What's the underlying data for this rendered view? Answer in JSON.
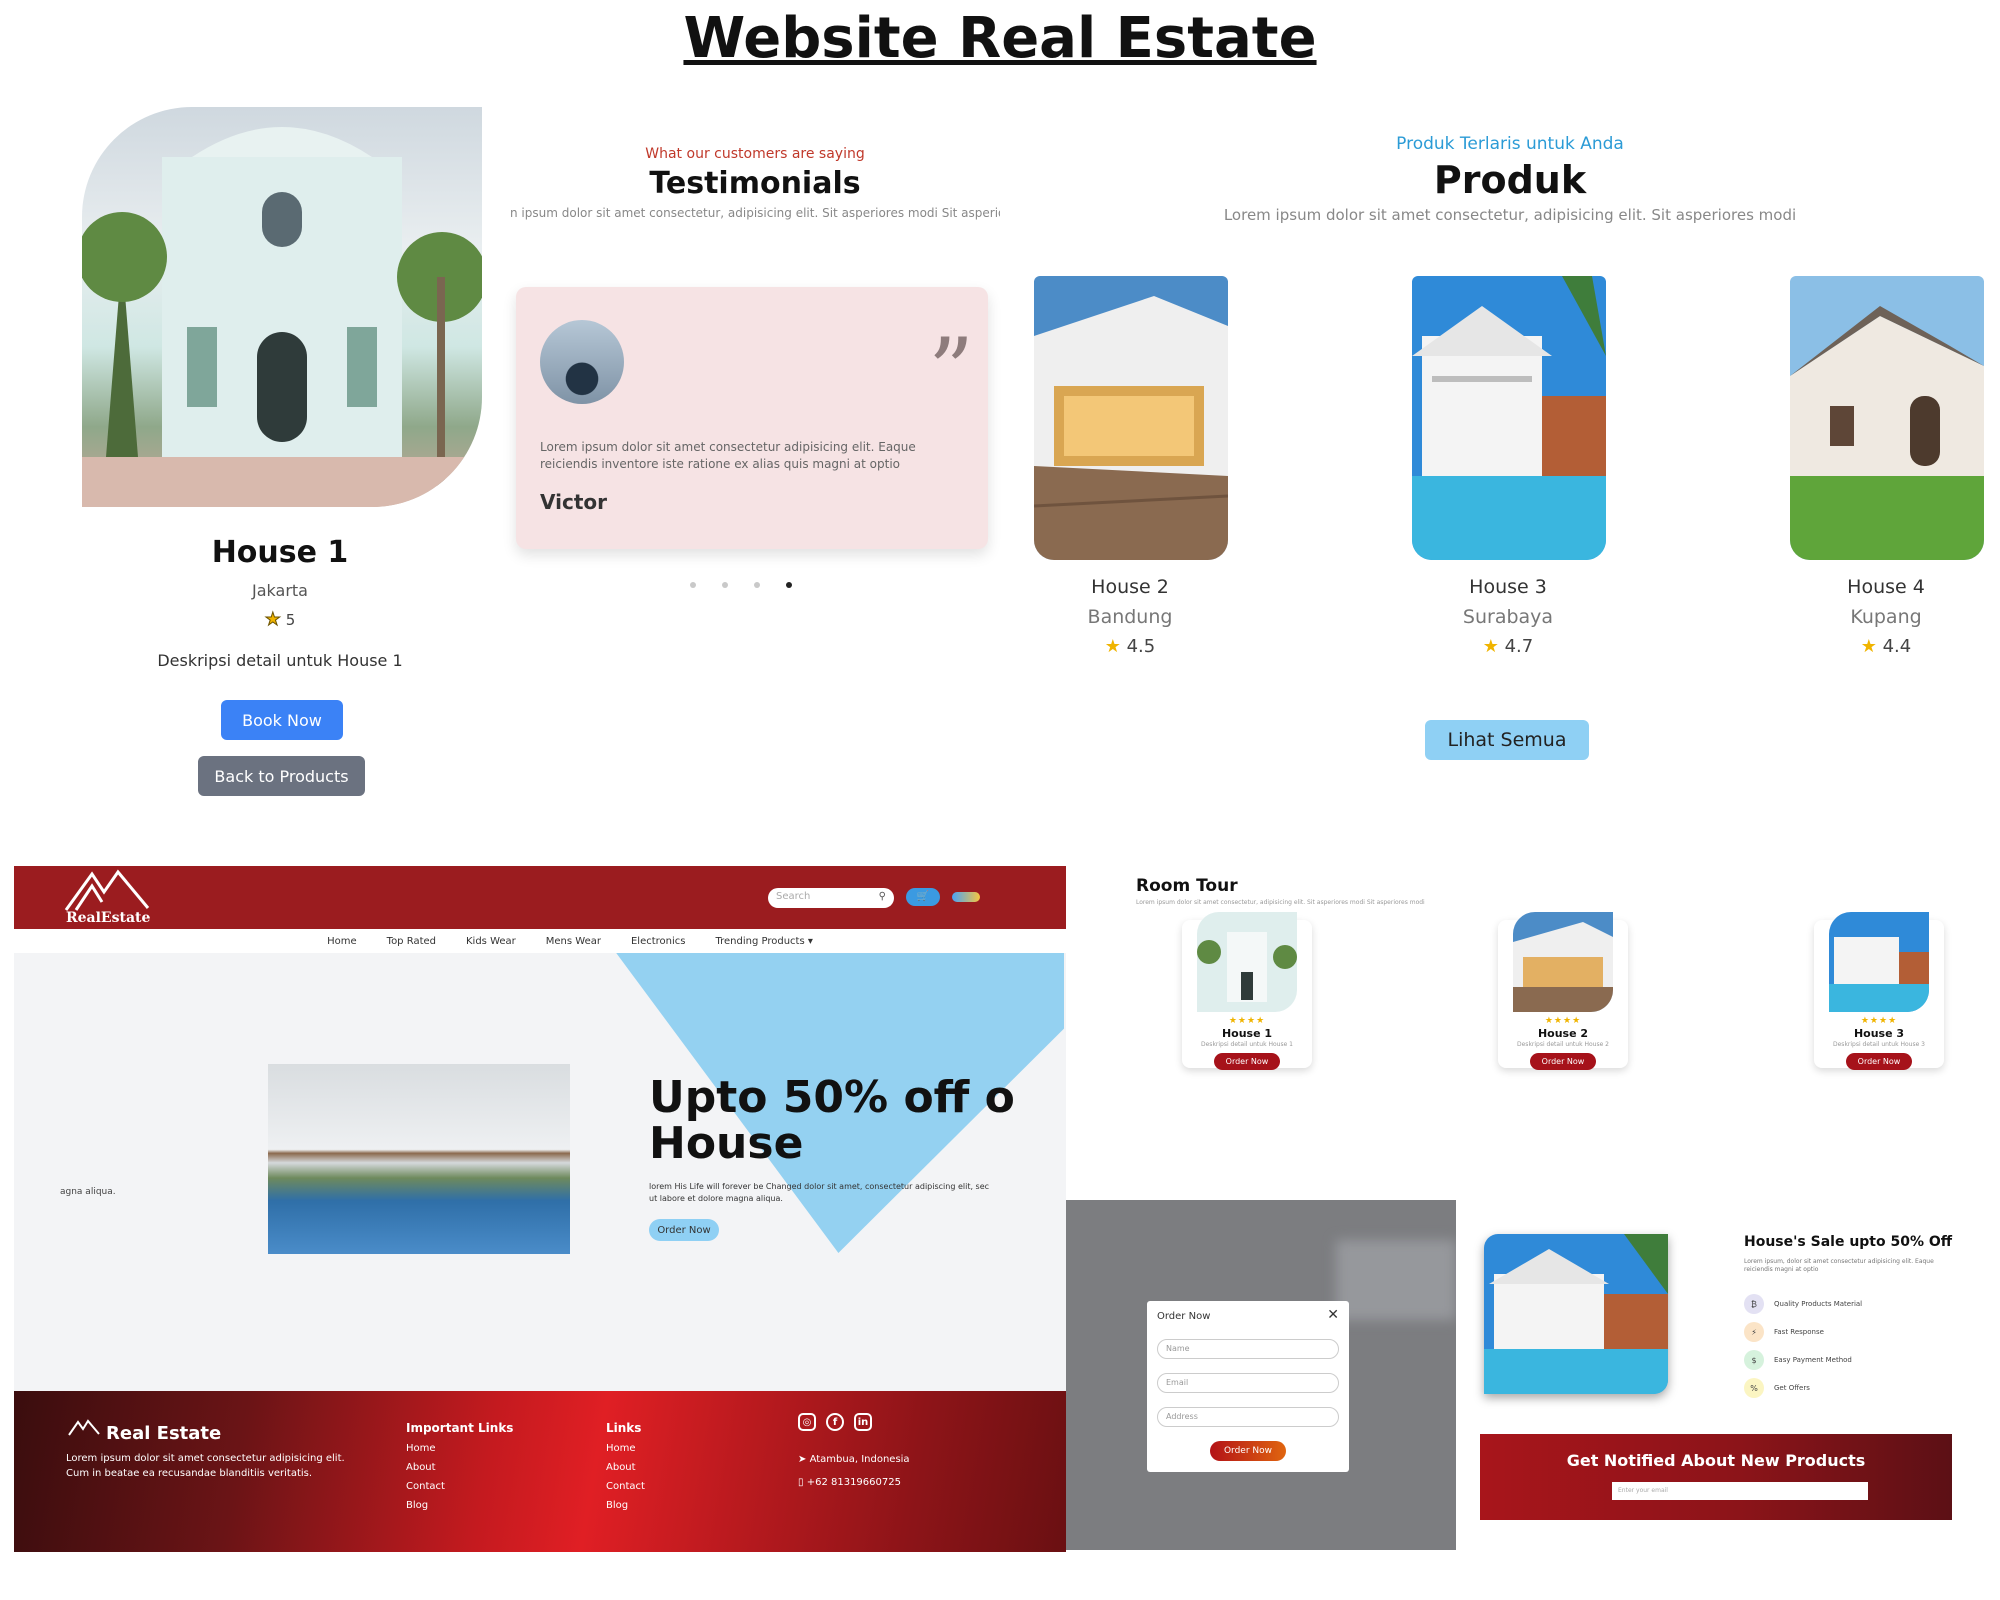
{
  "page": {
    "title": "Website Real Estate"
  },
  "detail": {
    "name": "House 1",
    "location": "Jakarta",
    "rating": "5",
    "description": "Deskripsi detail untuk House 1",
    "book_label": "Book Now",
    "back_label": "Back to Products"
  },
  "testimonials": {
    "kicker": "What our customers are saying",
    "title": "Testimonials",
    "subtitle": "n ipsum dolor sit amet consectetur, adipisicing elit. Sit asperiores modi Sit asperiores mc",
    "quote_mark": "”",
    "text": "Lorem ipsum dolor sit amet consectetur adipisicing elit. Eaque reiciendis inventore iste ratione ex alias quis magni at optio",
    "name": "Victor",
    "slide_count": 4,
    "active_slide": 4
  },
  "produk": {
    "kicker": "Produk Terlaris untuk Anda",
    "title": "Produk",
    "subtitle": "Lorem ipsum dolor sit amet consectetur, adipisicing elit. Sit asperiores modi",
    "items": [
      {
        "name": "House 2",
        "location": "Bandung",
        "rating": "4.5"
      },
      {
        "name": "House 3",
        "location": "Surabaya",
        "rating": "4.7"
      },
      {
        "name": "House 4",
        "location": "Kupang",
        "rating": "4.4"
      }
    ],
    "view_all_label": "Lihat Semua"
  },
  "site": {
    "logo_text": "RealEstate",
    "search_placeholder": "Search",
    "menu": [
      "Home",
      "Top Rated",
      "Kids Wear",
      "Mens Wear",
      "Electronics",
      "Trending Products ▾"
    ],
    "hero_left_text": "agna aliqua.",
    "hero_title": "Upto 50% off o House",
    "hero_subtitle": "lorem His Life will forever be Changed dolor sit amet, consectetur adipiscing elit, sec ut labore et dolore magna aliqua.",
    "hero_button": "Order Now",
    "footer": {
      "brand": "Real Estate",
      "description": "Lorem ipsum dolor sit amet consectetur adipisicing elit. Cum in beatae ea recusandae blanditiis veritatis.",
      "important_title": "Important Links",
      "important_links": [
        "Home",
        "About",
        "Contact",
        "Blog"
      ],
      "links_title": "Links",
      "links": [
        "Home",
        "About",
        "Contact",
        "Blog"
      ],
      "address": "Atambua, Indonesia",
      "phone": "+62 81319660725"
    }
  },
  "room_tour": {
    "title": "Room Tour",
    "subtitle": "Lorem ipsum dolor sit amet consectetur, adipisicing elit. Sit asperiores modi Sit asperiores modi",
    "stars": "★★★★",
    "items": [
      {
        "name": "House 1",
        "desc": "Deskripsi detail untuk House 1",
        "button": "Order Now"
      },
      {
        "name": "House 2",
        "desc": "Deskripsi detail untuk House 2",
        "button": "Order Now"
      },
      {
        "name": "House 3",
        "desc": "Deskripsi detail untuk House 3",
        "button": "Order Now"
      }
    ]
  },
  "order_modal": {
    "title": "Order Now",
    "close": "✕",
    "name_placeholder": "Name",
    "email_placeholder": "Email",
    "address_placeholder": "Address",
    "button": "Order Now"
  },
  "sale": {
    "title": "House's Sale upto 50% Off",
    "subtitle": "Lorem ipsum, dolor sit amet consectetur adipisicing elit. Eaque reiciendis magni at optio",
    "features": [
      "Quality Products Material",
      "Fast Response",
      "Easy Payment Method",
      "Get Offers"
    ],
    "notify_title": "Get Notified About New Products",
    "notify_placeholder": "Enter your email"
  },
  "colors": {
    "brand_red": "#9b1c1f",
    "primary_blue": "#3b82f6",
    "light_blue": "#8fd0f4",
    "star": "#f0b400"
  }
}
